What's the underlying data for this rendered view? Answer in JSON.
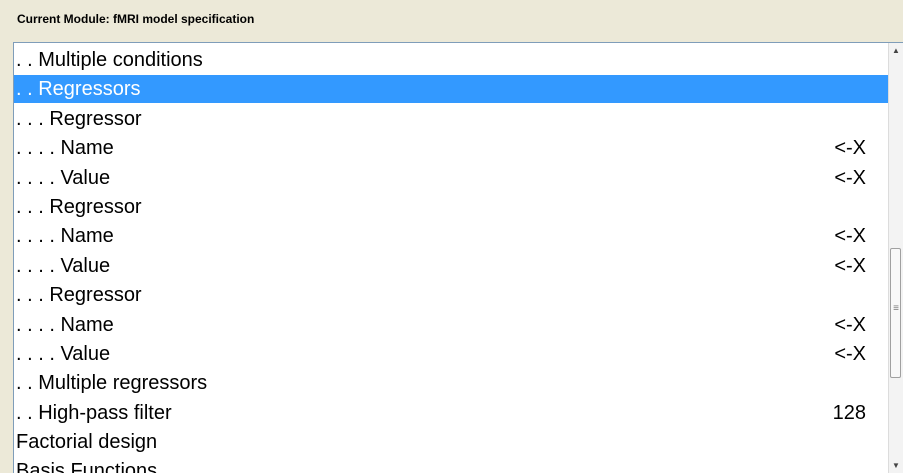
{
  "module": {
    "title": "Current Module: fMRI model specification"
  },
  "list": {
    "selected_index": 1,
    "items": [
      {
        "label": ". . Multiple conditions",
        "value": ""
      },
      {
        "label": ". . Regressors",
        "value": ""
      },
      {
        "label": ". . . Regressor",
        "value": ""
      },
      {
        "label": ". . . . Name",
        "value": "<-X"
      },
      {
        "label": ". . . . Value",
        "value": "<-X"
      },
      {
        "label": ". . . Regressor",
        "value": ""
      },
      {
        "label": ". . . . Name",
        "value": "<-X"
      },
      {
        "label": ". . . . Value",
        "value": "<-X"
      },
      {
        "label": ". . . Regressor",
        "value": ""
      },
      {
        "label": ". . . . Name",
        "value": "<-X"
      },
      {
        "label": ". . . . Value",
        "value": "<-X"
      },
      {
        "label": ". . Multiple regressors",
        "value": ""
      },
      {
        "label": ". . High-pass filter",
        "value": "128"
      },
      {
        "label": "Factorial design",
        "value": ""
      },
      {
        "label": "Basis Functions",
        "value": ""
      }
    ]
  },
  "scrollbar": {
    "up_icon": "scroll-up-arrow-icon",
    "down_icon": "scroll-down-arrow-icon",
    "grip_icon": "grip-icon"
  }
}
